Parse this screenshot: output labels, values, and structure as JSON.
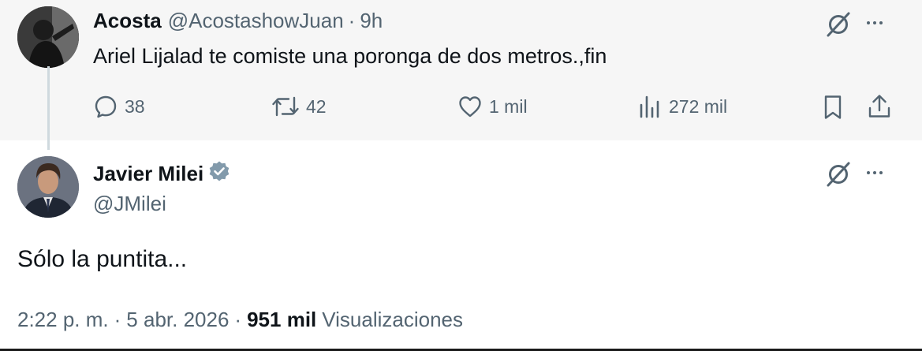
{
  "parent_tweet": {
    "author_name": "Acosta",
    "author_handle": "@AcostashowJuan",
    "separator": "·",
    "time": "9h",
    "text": "Ariel Lijalad te comiste una poronga de dos metros.,fin",
    "actions": {
      "replies": "38",
      "reposts": "42",
      "likes": "1 mil",
      "views": "272 mil"
    }
  },
  "main_tweet": {
    "author_name": "Javier Milei",
    "author_handle": "@JMilei",
    "verified": true,
    "text": "Sólo la puntita...",
    "time": "2:22 p. m.",
    "separator": "·",
    "date": "5 abr. 2026",
    "views_count": "951 mil",
    "views_label": "Visualizaciones"
  },
  "colors": {
    "text_primary": "#0f1419",
    "text_secondary": "#536471",
    "parent_background": "#f6f6f6",
    "thread_line": "#cfd9de",
    "verified_badge": "#829aab"
  },
  "icons": {
    "reply": "reply-icon",
    "repost": "repost-icon",
    "like": "like-icon",
    "views": "views-icon",
    "bookmark": "bookmark-icon",
    "share": "share-icon",
    "grok": "grok-icon",
    "more": "more-icon",
    "verified": "verified-badge-icon"
  }
}
